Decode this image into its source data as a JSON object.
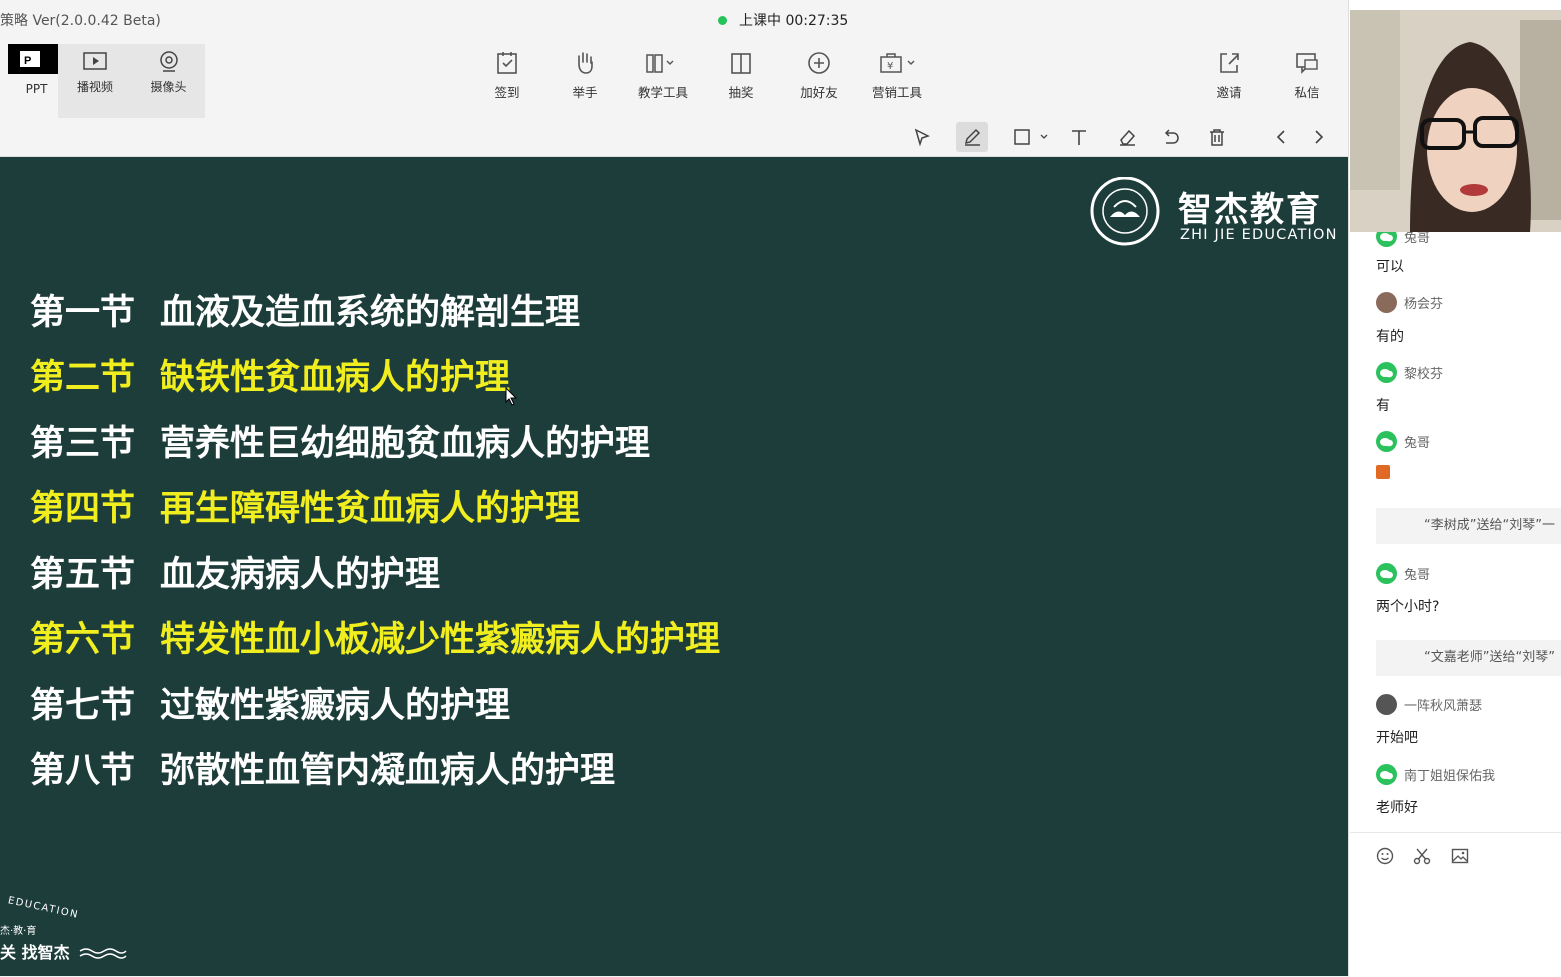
{
  "app": {
    "title": "策略 Ver(2.0.0.42 Beta)",
    "status": "上课中 00:27:35"
  },
  "modes": [
    {
      "label": "PPT",
      "icon": "ppt-icon",
      "active": true
    },
    {
      "label": "播视频",
      "icon": "play-video-icon"
    },
    {
      "label": "摄像头",
      "icon": "webcam-icon"
    }
  ],
  "tools": [
    {
      "label": "签到",
      "icon": "checkin-icon"
    },
    {
      "label": "举手",
      "icon": "raise-hand-icon"
    },
    {
      "label": "教学工具",
      "icon": "teaching-tools-icon"
    },
    {
      "label": "抽奖",
      "icon": "lottery-icon"
    },
    {
      "label": "加好友",
      "icon": "add-friend-icon"
    },
    {
      "label": "营销工具",
      "icon": "marketing-tools-icon"
    },
    {
      "label": "邀请",
      "icon": "invite-icon"
    },
    {
      "label": "私信",
      "icon": "private-message-icon"
    }
  ],
  "annotation_tools": [
    "select-arrow-icon",
    "pen-icon",
    "rectangle-icon",
    "text-icon",
    "eraser-icon",
    "undo-icon",
    "delete-icon",
    "prev-page-icon",
    "next-page-icon"
  ],
  "slide": {
    "logo_cn": "智杰教育",
    "logo_en": "ZHI JIE EDUCATION",
    "rows": [
      {
        "section": "第一节",
        "title": "血液及造血系统的解剖生理",
        "highlight": false
      },
      {
        "section": "第二节",
        "title": "缺铁性贫血病人的护理",
        "highlight": true
      },
      {
        "section": "第三节",
        "title": "营养性巨幼细胞贫血病人的护理",
        "highlight": false
      },
      {
        "section": "第四节",
        "title": "再生障碍性贫血病人的护理",
        "highlight": true
      },
      {
        "section": "第五节",
        "title": "血友病病人的护理",
        "highlight": false
      },
      {
        "section": "第六节",
        "title": "特发性血小板减少性紫癜病人的护理",
        "highlight": true
      },
      {
        "section": "第七节",
        "title": "过敏性紫癜病人的护理",
        "highlight": false
      },
      {
        "section": "第八节",
        "title": "弥散性血管内凝血病人的护理",
        "highlight": false
      }
    ],
    "corner_en": "EDUCATION",
    "corner_line1": "杰·教·育",
    "corner_line2": "关 找智杰"
  },
  "chat": {
    "messages": [
      {
        "name": "兔哥",
        "text": "可以",
        "avatar": "wechat"
      },
      {
        "name": "杨会芬",
        "text": "有的",
        "avatar": "photo"
      },
      {
        "name": "黎校芬",
        "text": "有",
        "avatar": "wechat"
      },
      {
        "name": "兔哥",
        "text": "",
        "avatar": "wechat"
      },
      {
        "gift": "“李树成”送给“刘琴”一"
      },
      {
        "name": "兔哥",
        "text": "两个小时?",
        "avatar": "wechat"
      },
      {
        "gift": "“文嘉老师”送给“刘琴”"
      },
      {
        "name": "一阵秋风萧瑟",
        "text": "开始吧",
        "avatar": "photo"
      },
      {
        "name": "南丁姐姐保佑我",
        "text": "老师好",
        "avatar": "wechat"
      }
    ]
  },
  "chat_tools": [
    "emoji-icon",
    "scissors-icon",
    "image-icon"
  ],
  "colors": {
    "slide_bg": "#1c3d3a",
    "highlight": "#f1ee1f",
    "live_dot": "#25c35a"
  }
}
